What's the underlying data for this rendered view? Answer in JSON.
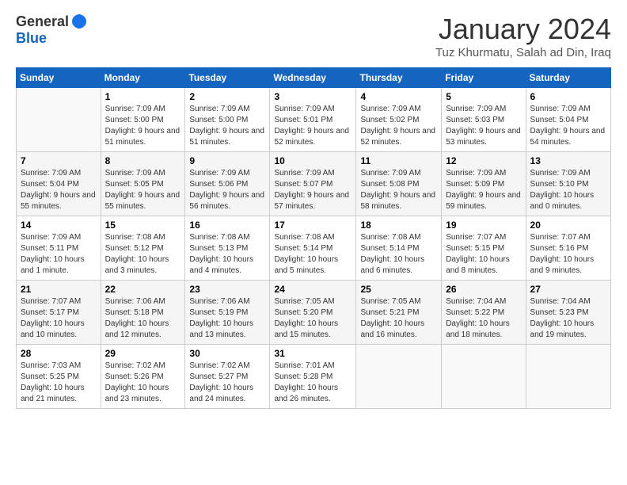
{
  "logo": {
    "general": "General",
    "blue": "Blue"
  },
  "header": {
    "title": "January 2024",
    "location": "Tuz Khurmatu, Salah ad Din, Iraq"
  },
  "columns": [
    "Sunday",
    "Monday",
    "Tuesday",
    "Wednesday",
    "Thursday",
    "Friday",
    "Saturday"
  ],
  "weeks": [
    [
      {
        "day": "",
        "sunrise": "",
        "sunset": "",
        "daylight": ""
      },
      {
        "day": "1",
        "sunrise": "Sunrise: 7:09 AM",
        "sunset": "Sunset: 5:00 PM",
        "daylight": "Daylight: 9 hours and 51 minutes."
      },
      {
        "day": "2",
        "sunrise": "Sunrise: 7:09 AM",
        "sunset": "Sunset: 5:00 PM",
        "daylight": "Daylight: 9 hours and 51 minutes."
      },
      {
        "day": "3",
        "sunrise": "Sunrise: 7:09 AM",
        "sunset": "Sunset: 5:01 PM",
        "daylight": "Daylight: 9 hours and 52 minutes."
      },
      {
        "day": "4",
        "sunrise": "Sunrise: 7:09 AM",
        "sunset": "Sunset: 5:02 PM",
        "daylight": "Daylight: 9 hours and 52 minutes."
      },
      {
        "day": "5",
        "sunrise": "Sunrise: 7:09 AM",
        "sunset": "Sunset: 5:03 PM",
        "daylight": "Daylight: 9 hours and 53 minutes."
      },
      {
        "day": "6",
        "sunrise": "Sunrise: 7:09 AM",
        "sunset": "Sunset: 5:04 PM",
        "daylight": "Daylight: 9 hours and 54 minutes."
      }
    ],
    [
      {
        "day": "7",
        "sunrise": "Sunrise: 7:09 AM",
        "sunset": "Sunset: 5:04 PM",
        "daylight": "Daylight: 9 hours and 55 minutes."
      },
      {
        "day": "8",
        "sunrise": "Sunrise: 7:09 AM",
        "sunset": "Sunset: 5:05 PM",
        "daylight": "Daylight: 9 hours and 55 minutes."
      },
      {
        "day": "9",
        "sunrise": "Sunrise: 7:09 AM",
        "sunset": "Sunset: 5:06 PM",
        "daylight": "Daylight: 9 hours and 56 minutes."
      },
      {
        "day": "10",
        "sunrise": "Sunrise: 7:09 AM",
        "sunset": "Sunset: 5:07 PM",
        "daylight": "Daylight: 9 hours and 57 minutes."
      },
      {
        "day": "11",
        "sunrise": "Sunrise: 7:09 AM",
        "sunset": "Sunset: 5:08 PM",
        "daylight": "Daylight: 9 hours and 58 minutes."
      },
      {
        "day": "12",
        "sunrise": "Sunrise: 7:09 AM",
        "sunset": "Sunset: 5:09 PM",
        "daylight": "Daylight: 9 hours and 59 minutes."
      },
      {
        "day": "13",
        "sunrise": "Sunrise: 7:09 AM",
        "sunset": "Sunset: 5:10 PM",
        "daylight": "Daylight: 10 hours and 0 minutes."
      }
    ],
    [
      {
        "day": "14",
        "sunrise": "Sunrise: 7:09 AM",
        "sunset": "Sunset: 5:11 PM",
        "daylight": "Daylight: 10 hours and 1 minute."
      },
      {
        "day": "15",
        "sunrise": "Sunrise: 7:08 AM",
        "sunset": "Sunset: 5:12 PM",
        "daylight": "Daylight: 10 hours and 3 minutes."
      },
      {
        "day": "16",
        "sunrise": "Sunrise: 7:08 AM",
        "sunset": "Sunset: 5:13 PM",
        "daylight": "Daylight: 10 hours and 4 minutes."
      },
      {
        "day": "17",
        "sunrise": "Sunrise: 7:08 AM",
        "sunset": "Sunset: 5:14 PM",
        "daylight": "Daylight: 10 hours and 5 minutes."
      },
      {
        "day": "18",
        "sunrise": "Sunrise: 7:08 AM",
        "sunset": "Sunset: 5:14 PM",
        "daylight": "Daylight: 10 hours and 6 minutes."
      },
      {
        "day": "19",
        "sunrise": "Sunrise: 7:07 AM",
        "sunset": "Sunset: 5:15 PM",
        "daylight": "Daylight: 10 hours and 8 minutes."
      },
      {
        "day": "20",
        "sunrise": "Sunrise: 7:07 AM",
        "sunset": "Sunset: 5:16 PM",
        "daylight": "Daylight: 10 hours and 9 minutes."
      }
    ],
    [
      {
        "day": "21",
        "sunrise": "Sunrise: 7:07 AM",
        "sunset": "Sunset: 5:17 PM",
        "daylight": "Daylight: 10 hours and 10 minutes."
      },
      {
        "day": "22",
        "sunrise": "Sunrise: 7:06 AM",
        "sunset": "Sunset: 5:18 PM",
        "daylight": "Daylight: 10 hours and 12 minutes."
      },
      {
        "day": "23",
        "sunrise": "Sunrise: 7:06 AM",
        "sunset": "Sunset: 5:19 PM",
        "daylight": "Daylight: 10 hours and 13 minutes."
      },
      {
        "day": "24",
        "sunrise": "Sunrise: 7:05 AM",
        "sunset": "Sunset: 5:20 PM",
        "daylight": "Daylight: 10 hours and 15 minutes."
      },
      {
        "day": "25",
        "sunrise": "Sunrise: 7:05 AM",
        "sunset": "Sunset: 5:21 PM",
        "daylight": "Daylight: 10 hours and 16 minutes."
      },
      {
        "day": "26",
        "sunrise": "Sunrise: 7:04 AM",
        "sunset": "Sunset: 5:22 PM",
        "daylight": "Daylight: 10 hours and 18 minutes."
      },
      {
        "day": "27",
        "sunrise": "Sunrise: 7:04 AM",
        "sunset": "Sunset: 5:23 PM",
        "daylight": "Daylight: 10 hours and 19 minutes."
      }
    ],
    [
      {
        "day": "28",
        "sunrise": "Sunrise: 7:03 AM",
        "sunset": "Sunset: 5:25 PM",
        "daylight": "Daylight: 10 hours and 21 minutes."
      },
      {
        "day": "29",
        "sunrise": "Sunrise: 7:02 AM",
        "sunset": "Sunset: 5:26 PM",
        "daylight": "Daylight: 10 hours and 23 minutes."
      },
      {
        "day": "30",
        "sunrise": "Sunrise: 7:02 AM",
        "sunset": "Sunset: 5:27 PM",
        "daylight": "Daylight: 10 hours and 24 minutes."
      },
      {
        "day": "31",
        "sunrise": "Sunrise: 7:01 AM",
        "sunset": "Sunset: 5:28 PM",
        "daylight": "Daylight: 10 hours and 26 minutes."
      },
      {
        "day": "",
        "sunrise": "",
        "sunset": "",
        "daylight": ""
      },
      {
        "day": "",
        "sunrise": "",
        "sunset": "",
        "daylight": ""
      },
      {
        "day": "",
        "sunrise": "",
        "sunset": "",
        "daylight": ""
      }
    ]
  ]
}
